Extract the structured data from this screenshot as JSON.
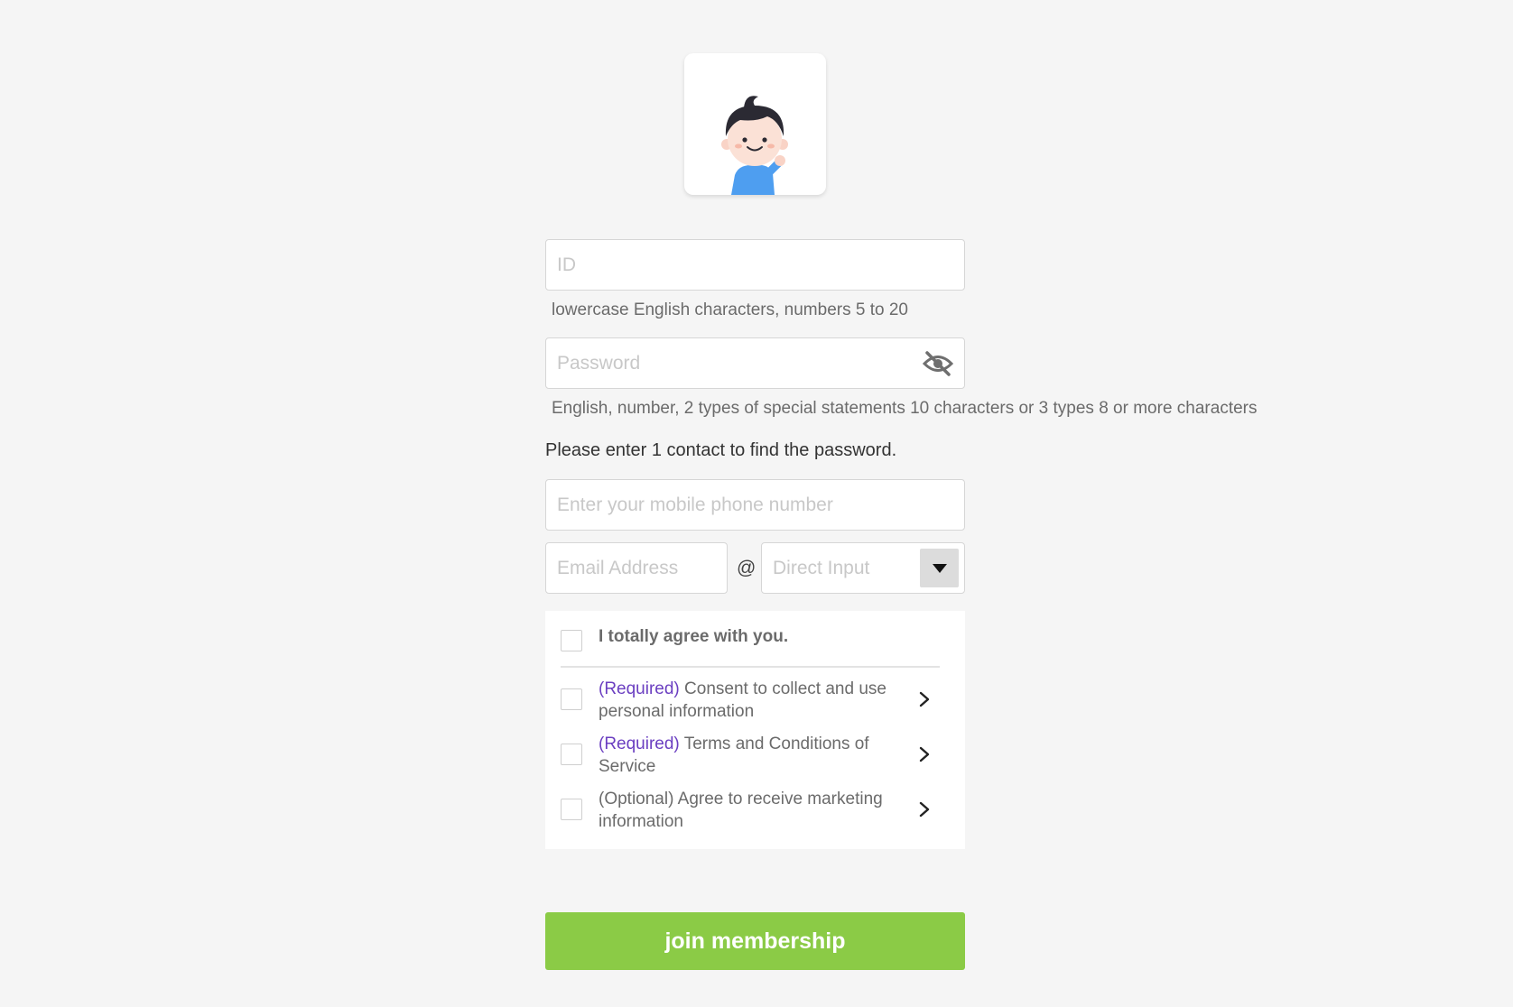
{
  "form": {
    "id_placeholder": "ID",
    "id_hint": "lowercase English characters, numbers 5 to 20",
    "password_placeholder": "Password",
    "password_hint": "English, number, 2 types of special statements 10 characters or 3 types 8 or more characters",
    "contact_label": "Please enter 1 contact to find the password.",
    "phone_placeholder": "Enter your mobile phone number",
    "email_placeholder": "Email Address",
    "at_sign": "@",
    "domain_placeholder": "Direct Input"
  },
  "terms": {
    "all_agree": "I totally agree with you.",
    "items": [
      {
        "tag": "(Required)",
        "text": " Consent to collect and use personal information"
      },
      {
        "tag": "(Required)",
        "text": " Terms and Conditions of Service"
      },
      {
        "tag": "",
        "text": "(Optional) Agree to receive marketing information"
      }
    ]
  },
  "actions": {
    "join_label": "join membership"
  },
  "colors": {
    "accent_green": "#8bcb46",
    "required_purple": "#6b3fc1",
    "background": "#f5f5f5"
  }
}
